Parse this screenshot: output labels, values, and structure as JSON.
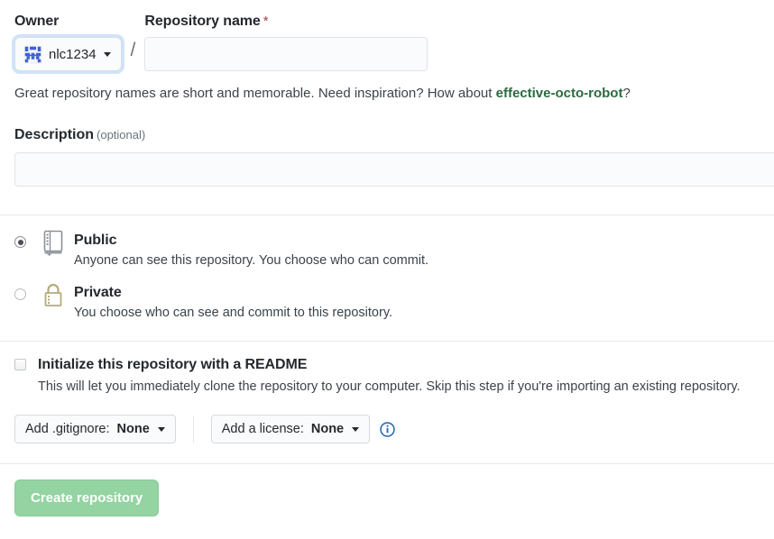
{
  "owner": {
    "label": "Owner",
    "name": "nlc1234",
    "avatar_icon": "identicon-avatar",
    "caret_icon": "chevron-down-icon"
  },
  "separator": "/",
  "repo_name": {
    "label": "Repository name",
    "required_marker": "*",
    "value": "",
    "placeholder": ""
  },
  "hint": {
    "before": "Great repository names are short and memorable. Need inspiration? How about ",
    "suggestion": "effective-octo-robot",
    "after": "?"
  },
  "description": {
    "label": "Description",
    "optional_note": "(optional)",
    "value": "",
    "placeholder": ""
  },
  "visibility": {
    "options": [
      {
        "title": "Public",
        "description": "Anyone can see this repository. You choose who can commit.",
        "icon": "repo-book-icon",
        "selected": true
      },
      {
        "title": "Private",
        "description": "You choose who can see and commit to this repository.",
        "icon": "lock-icon",
        "selected": false
      }
    ]
  },
  "readme": {
    "title": "Initialize this repository with a README",
    "description": "This will let you immediately clone the repository to your computer. Skip this step if you're importing an existing repository.",
    "checked": false
  },
  "gitignore": {
    "prefix": "Add .gitignore:",
    "value": "None",
    "caret_icon": "chevron-down-icon"
  },
  "license": {
    "prefix": "Add a license:",
    "value": "None",
    "caret_icon": "chevron-down-icon",
    "info_icon": "info-circle-icon"
  },
  "submit": {
    "label": "Create repository",
    "enabled": false
  },
  "colors": {
    "suggestion_green": "#2b6a3f",
    "required_red": "#a8414b",
    "button_green": "#94d3a2",
    "focus_ring_blue": "#cfe4fb",
    "lock_khaki": "#b3ab7d",
    "info_blue": "#2b6cb0"
  }
}
